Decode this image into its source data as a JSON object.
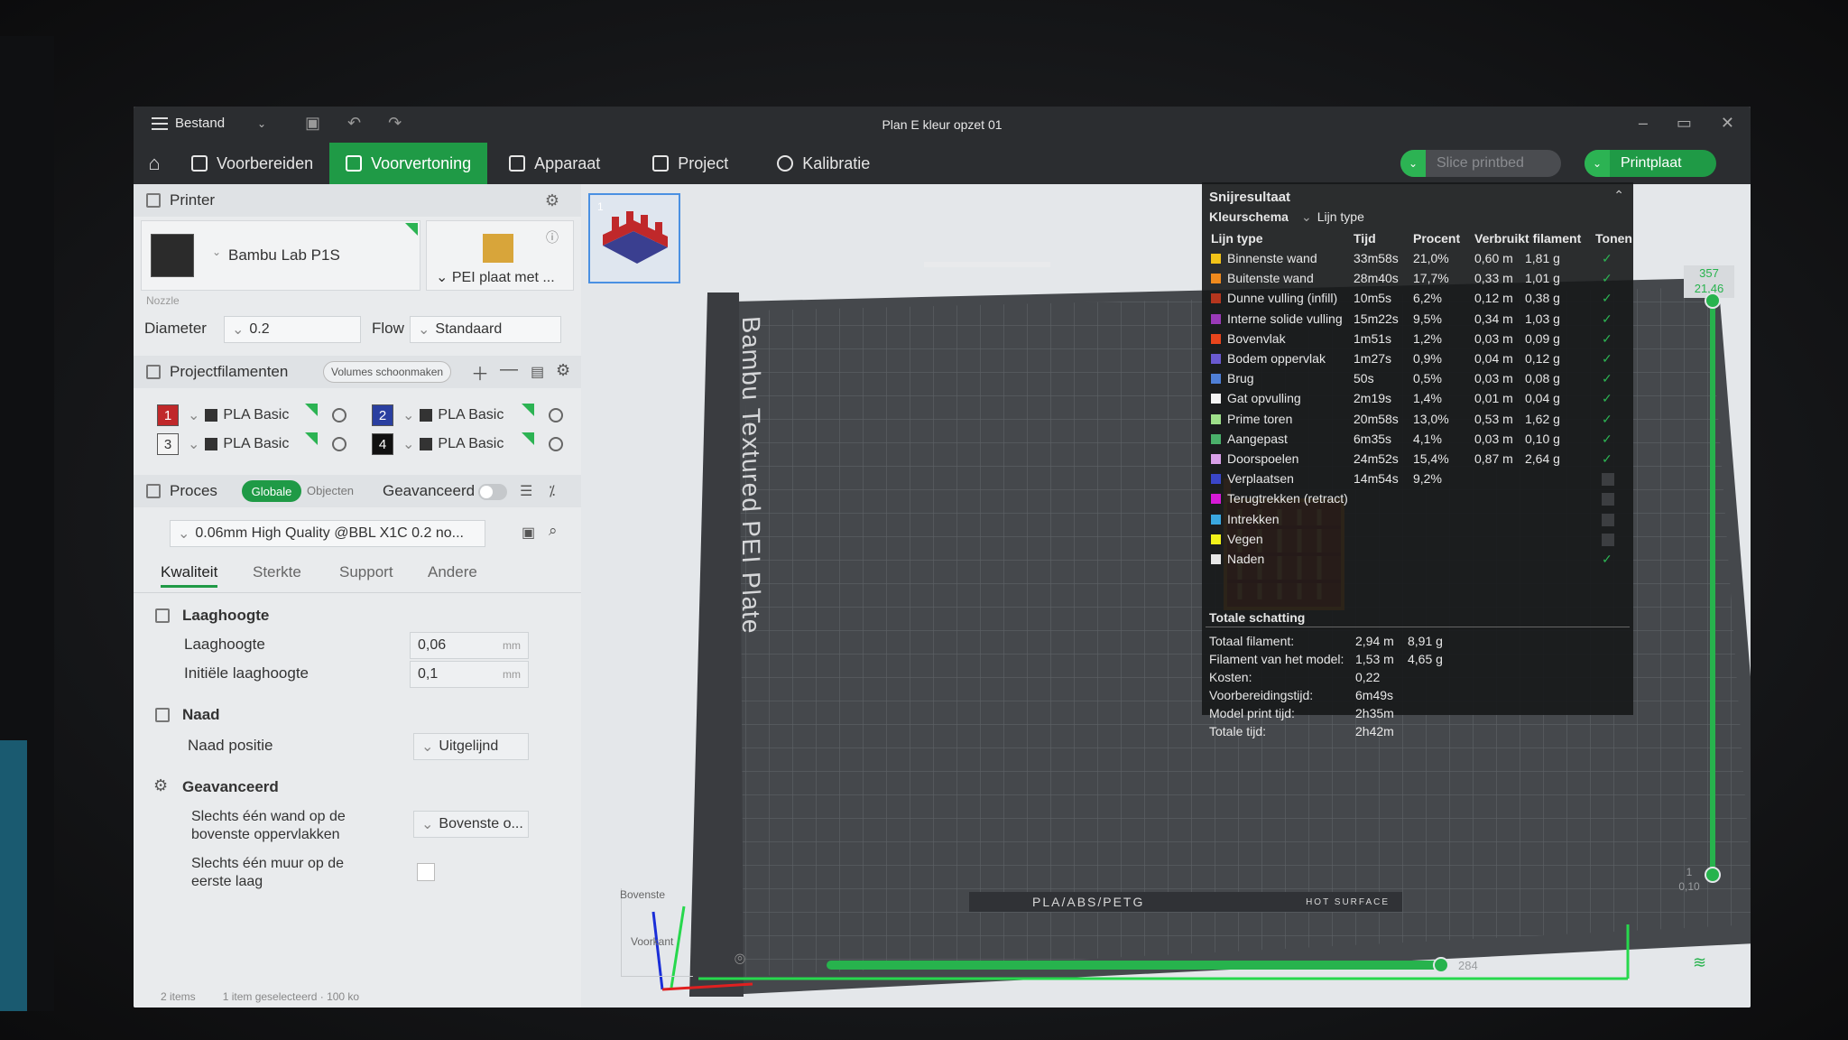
{
  "titlebar": {
    "menu_label": "Bestand",
    "window_title": "Plan E kleur opzet 01"
  },
  "nav": {
    "tabs": [
      "Voorbereiden",
      "Voorvertoning",
      "Apparaat",
      "Project",
      "Kalibratie"
    ],
    "slice_label": "Slice printbed",
    "print_label": "Printplaat"
  },
  "printer": {
    "section_label": "Printer",
    "name": "Bambu Lab P1S",
    "plate": "PEI plaat met ...",
    "nozzle_label": "Nozzle",
    "diameter_label": "Diameter",
    "diameter_value": "0.2",
    "flow_label": "Flow",
    "flow_value": "Standaard"
  },
  "filaments": {
    "section_label": "Projectfilamenten",
    "clean_chip": "Volumes schoonmaken",
    "items": [
      {
        "num": "1",
        "name": "PLA Basic",
        "color": "#c0282a"
      },
      {
        "num": "2",
        "name": "PLA Basic",
        "color": "#2a3fa0"
      },
      {
        "num": "3",
        "name": "PLA Basic",
        "color": "#f4f4f4"
      },
      {
        "num": "4",
        "name": "PLA Basic",
        "color": "#111111"
      }
    ]
  },
  "process": {
    "section_label": "Proces",
    "tab_global": "Globale",
    "tab_objects": "Objecten",
    "advanced_label": "Geavanceerd",
    "profile": "0.06mm High Quality @BBL X1C 0.2 no...",
    "subtabs": [
      "Kwaliteit",
      "Sterkte",
      "Support",
      "Andere"
    ],
    "group_layer": "Laaghoogte",
    "layer_height_label": "Laaghoogte",
    "layer_height_value": "0,06",
    "layer_unit": "mm",
    "initial_layer_label": "Initiële laaghoogte",
    "initial_layer_value": "0,1",
    "group_seam": "Naad",
    "seam_label": "Naad positie",
    "seam_value": "Uitgelijnd",
    "group_advanced": "Geavanceerd",
    "one_wall_top_label_1": "Slechts één wand op de",
    "one_wall_top_label_2": "bovenste oppervlakken",
    "one_wall_top_value": "Bovenste o...",
    "one_wall_first_label_1": "Slechts één muur op de",
    "one_wall_first_label_2": "eerste laag"
  },
  "statusbar": {
    "items": "2 items",
    "selected": "1 item geselecteerd · 100 ko"
  },
  "viewport": {
    "thumb_number": "1",
    "plate_text": "Bambu Textured PEI Plate",
    "plate_label_strip": "PLA/ABS/PETG",
    "hot_surface": "HOT SURFACE",
    "axis_top": "Bovenste",
    "axis_front": "Voorkant",
    "layer_top_num": "357",
    "layer_top_mm": "21,46",
    "layer_bottom_num": "1",
    "layer_bottom_mm": "0,10",
    "hslider_value": "284"
  },
  "results": {
    "title": "Snijresultaat",
    "scheme_label": "Kleurschema",
    "scheme_value": "Lijn type",
    "headers": [
      "Lijn type",
      "Tijd",
      "Procent",
      "Verbruikt filament",
      "Tonen"
    ],
    "rows": [
      {
        "name": "Binnenste wand",
        "time": "33m58s",
        "pct": "21,0%",
        "m": "0,60 m",
        "g": "1,81 g",
        "color": "#f2c318",
        "shown": true
      },
      {
        "name": "Buitenste wand",
        "time": "28m40s",
        "pct": "17,7%",
        "m": "0,33 m",
        "g": "1,01 g",
        "color": "#f08a1d",
        "shown": true
      },
      {
        "name": "Dunne vulling (infill)",
        "time": "10m5s",
        "pct": "6,2%",
        "m": "0,12 m",
        "g": "0,38 g",
        "color": "#b5361e",
        "shown": true
      },
      {
        "name": "Interne solide vulling",
        "time": "15m22s",
        "pct": "9,5%",
        "m": "0,34 m",
        "g": "1,03 g",
        "color": "#9a3ab8",
        "shown": true
      },
      {
        "name": "Bovenvlak",
        "time": "1m51s",
        "pct": "1,2%",
        "m": "0,03 m",
        "g": "0,09 g",
        "color": "#e8451c",
        "shown": true
      },
      {
        "name": "Bodem oppervlak",
        "time": "1m27s",
        "pct": "0,9%",
        "m": "0,04 m",
        "g": "0,12 g",
        "color": "#6a5ad0",
        "shown": true
      },
      {
        "name": "Brug",
        "time": "50s",
        "pct": "0,5%",
        "m": "0,03 m",
        "g": "0,08 g",
        "color": "#4f7fd6",
        "shown": true
      },
      {
        "name": "Gat opvulling",
        "time": "2m19s",
        "pct": "1,4%",
        "m": "0,01 m",
        "g": "0,04 g",
        "color": "#f4f4f4",
        "shown": true
      },
      {
        "name": "Prime toren",
        "time": "20m58s",
        "pct": "13,0%",
        "m": "0,53 m",
        "g": "1,62 g",
        "color": "#9ee08a",
        "shown": true
      },
      {
        "name": "Aangepast",
        "time": "6m35s",
        "pct": "4,1%",
        "m": "0,03 m",
        "g": "0,10 g",
        "color": "#4ab06a",
        "shown": true
      },
      {
        "name": "Doorspoelen",
        "time": "24m52s",
        "pct": "15,4%",
        "m": "0,87 m",
        "g": "2,64 g",
        "color": "#d9a0e8",
        "shown": true
      },
      {
        "name": "Verplaatsen",
        "time": "14m54s",
        "pct": "9,2%",
        "m": "",
        "g": "",
        "color": "#3a46c8",
        "shown": false
      },
      {
        "name": "Terugtrekken (retract)",
        "time": "",
        "pct": "",
        "m": "",
        "g": "",
        "color": "#d61ad6",
        "shown": false
      },
      {
        "name": "Intrekken",
        "time": "",
        "pct": "",
        "m": "",
        "g": "",
        "color": "#3aa8e0",
        "shown": false
      },
      {
        "name": "Vegen",
        "time": "",
        "pct": "",
        "m": "",
        "g": "",
        "color": "#f2f21a",
        "shown": false
      },
      {
        "name": "Naden",
        "time": "",
        "pct": "",
        "m": "",
        "g": "",
        "color": "#e8e8e8",
        "shown": true
      }
    ],
    "estimate_title": "Totale schatting",
    "estimates": [
      {
        "label": "Totaal filament:",
        "v1": "2,94 m",
        "v2": "8,91 g"
      },
      {
        "label": "Filament van het model:",
        "v1": "1,53 m",
        "v2": "4,65 g"
      },
      {
        "label": "Kosten:",
        "v1": "0,22",
        "v2": ""
      },
      {
        "label": "Voorbereidingstijd:",
        "v1": "6m49s",
        "v2": ""
      },
      {
        "label": "Model print tijd:",
        "v1": "2h35m",
        "v2": ""
      },
      {
        "label": "Totale tijd:",
        "v1": "2h42m",
        "v2": ""
      }
    ]
  },
  "colors": {
    "accent": "#1f9a46",
    "toolbar": "#2b2d30",
    "plate": "#4a4d52"
  }
}
